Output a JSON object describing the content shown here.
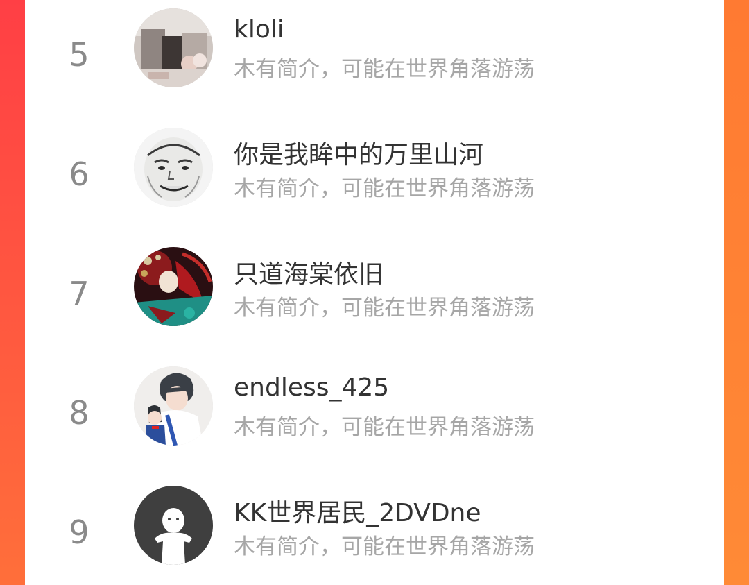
{
  "users": [
    {
      "rank": "5",
      "name": "kloli",
      "bio": "木有简介，可能在世界角落游荡",
      "avatar_icon": "photo-avatar-icon"
    },
    {
      "rank": "6",
      "name": "你是我眸中的万里山河",
      "bio": "木有简介，可能在世界角落游荡",
      "avatar_icon": "meme-face-avatar-icon"
    },
    {
      "rank": "7",
      "name": "只道海棠依旧",
      "bio": "木有简介，可能在世界角落游荡",
      "avatar_icon": "opera-art-avatar-icon"
    },
    {
      "rank": "8",
      "name": "endless_425",
      "bio": "木有简介，可能在世界角落游荡",
      "avatar_icon": "anime-avatar-icon"
    },
    {
      "rank": "9",
      "name": "KK世界居民_2DVDne",
      "bio": "木有简介，可能在世界角落游荡",
      "avatar_icon": "default-avatar-icon"
    }
  ],
  "colors": {
    "background_accent": "#ff5a3c",
    "rank_text": "#8a8a8a",
    "name_text": "#333333",
    "bio_text": "#a6a6a6"
  }
}
